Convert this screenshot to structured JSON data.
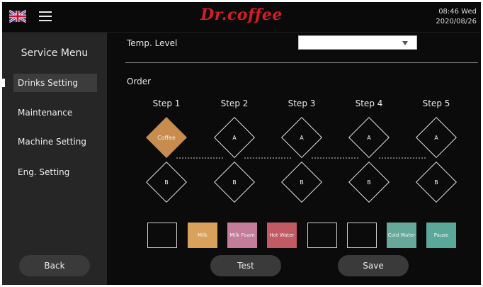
{
  "header": {
    "language_icon": "uk-flag-icon",
    "menu_icon": "hamburger-menu-icon",
    "brand": "Dr.coffee",
    "brand_color": "#d21f26",
    "time": "08:46 Wed",
    "date": "2020/08/26"
  },
  "sidebar": {
    "title": "Service Menu",
    "items": [
      {
        "label": "Drinks Setting",
        "active": true
      },
      {
        "label": "Maintenance",
        "active": false
      },
      {
        "label": "Machine Setting",
        "active": false
      },
      {
        "label": "Eng. Setting",
        "active": false
      }
    ],
    "back_label": "Back"
  },
  "main": {
    "temp_label": "Temp. Level",
    "temp_value": "",
    "order_label": "Order",
    "steps": [
      {
        "label": "Step 1",
        "a": "Coffee",
        "b": "B",
        "a_filled": true
      },
      {
        "label": "Step 2",
        "a": "A",
        "b": "B",
        "a_filled": false
      },
      {
        "label": "Step 3",
        "a": "A",
        "b": "B",
        "a_filled": false
      },
      {
        "label": "Step 4",
        "a": "A",
        "b": "B",
        "a_filled": false
      },
      {
        "label": "Step 5",
        "a": "A",
        "b": "B",
        "a_filled": false
      }
    ],
    "ingredients": [
      {
        "label": "",
        "color": ""
      },
      {
        "label": "Milk",
        "color": "#d8a25b"
      },
      {
        "label": "Milk Foam",
        "color": "#c47c9b"
      },
      {
        "label": "Hot Water",
        "color": "#c25a64"
      },
      {
        "label": "",
        "color": ""
      },
      {
        "label": "",
        "color": ""
      },
      {
        "label": "Cold Water",
        "color": "#66a99b"
      },
      {
        "label": "Pause",
        "color": "#5aa89a"
      }
    ],
    "test_label": "Test",
    "save_label": "Save",
    "coffee_color": "#c98c4f"
  }
}
